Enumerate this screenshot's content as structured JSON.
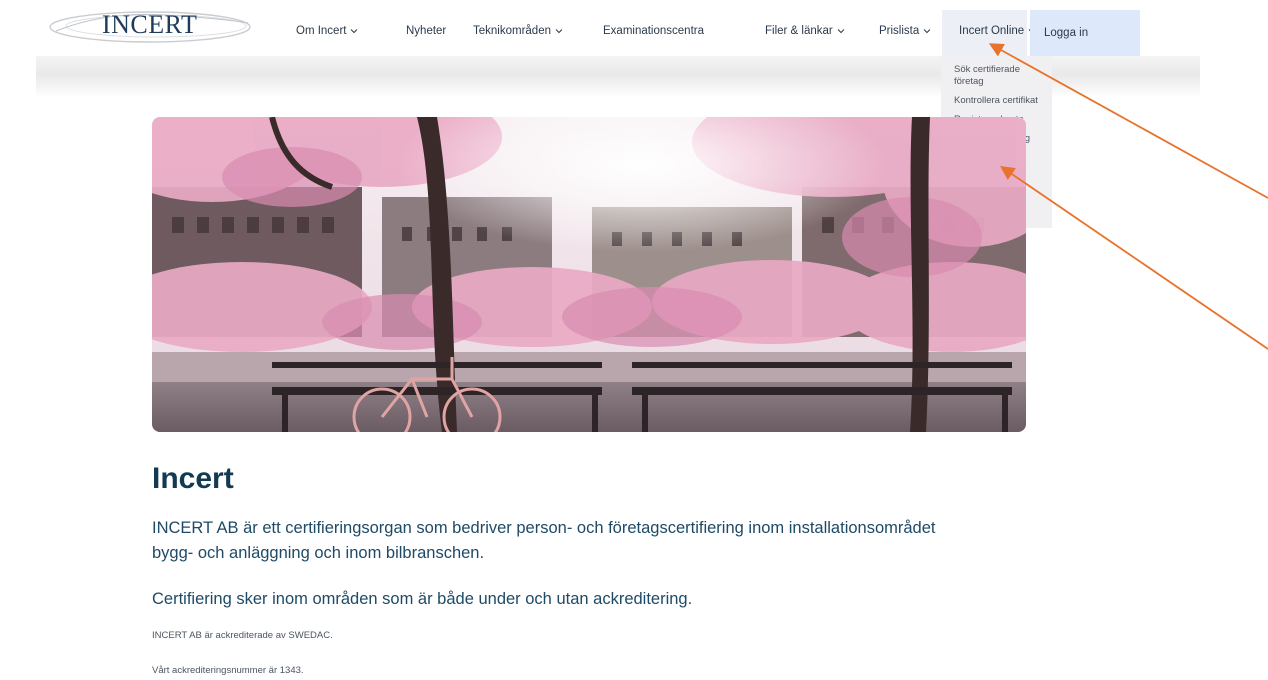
{
  "header": {
    "logo_text": "INCERT",
    "nav": [
      {
        "label": "Om Incert",
        "has_dropdown": true
      },
      {
        "label": "Nyheter",
        "has_dropdown": false
      },
      {
        "label": "Teknikområden",
        "has_dropdown": true
      },
      {
        "label": "Examinationscentra",
        "has_dropdown": false
      },
      {
        "label": "Filer & länkar",
        "has_dropdown": true
      },
      {
        "label": "Prislista",
        "has_dropdown": true
      },
      {
        "label": "Incert Online",
        "has_dropdown": true,
        "active": true
      }
    ],
    "login_label": "Logga in"
  },
  "dropdown": {
    "items": [
      {
        "label": "Sök certifierade företag"
      },
      {
        "label": "Kontrollera certifikat"
      },
      {
        "label": "Registrera konto"
      },
      {
        "label": "Registrera företag"
      }
    ]
  },
  "main": {
    "title": "Incert",
    "intro": "INCERT AB är ett certifieringsorgan som bedriver person- och företagscertifiering inom installationsområdet bygg- och anläggning och inom bilbranschen.",
    "subheading": "Certifiering sker inom områden som är både under och utan ackreditering.",
    "accreditation_text": "INCERT AB är ackrediterade av SWEDAC.",
    "accreditation_number_text": "Vårt ackrediteringsnummer är 1343."
  },
  "colors": {
    "annotation_arrow": "#e8732c",
    "title": "#123a52",
    "login_bg": "#dde9fb",
    "dropdown_bg": "#f0f0f2"
  }
}
